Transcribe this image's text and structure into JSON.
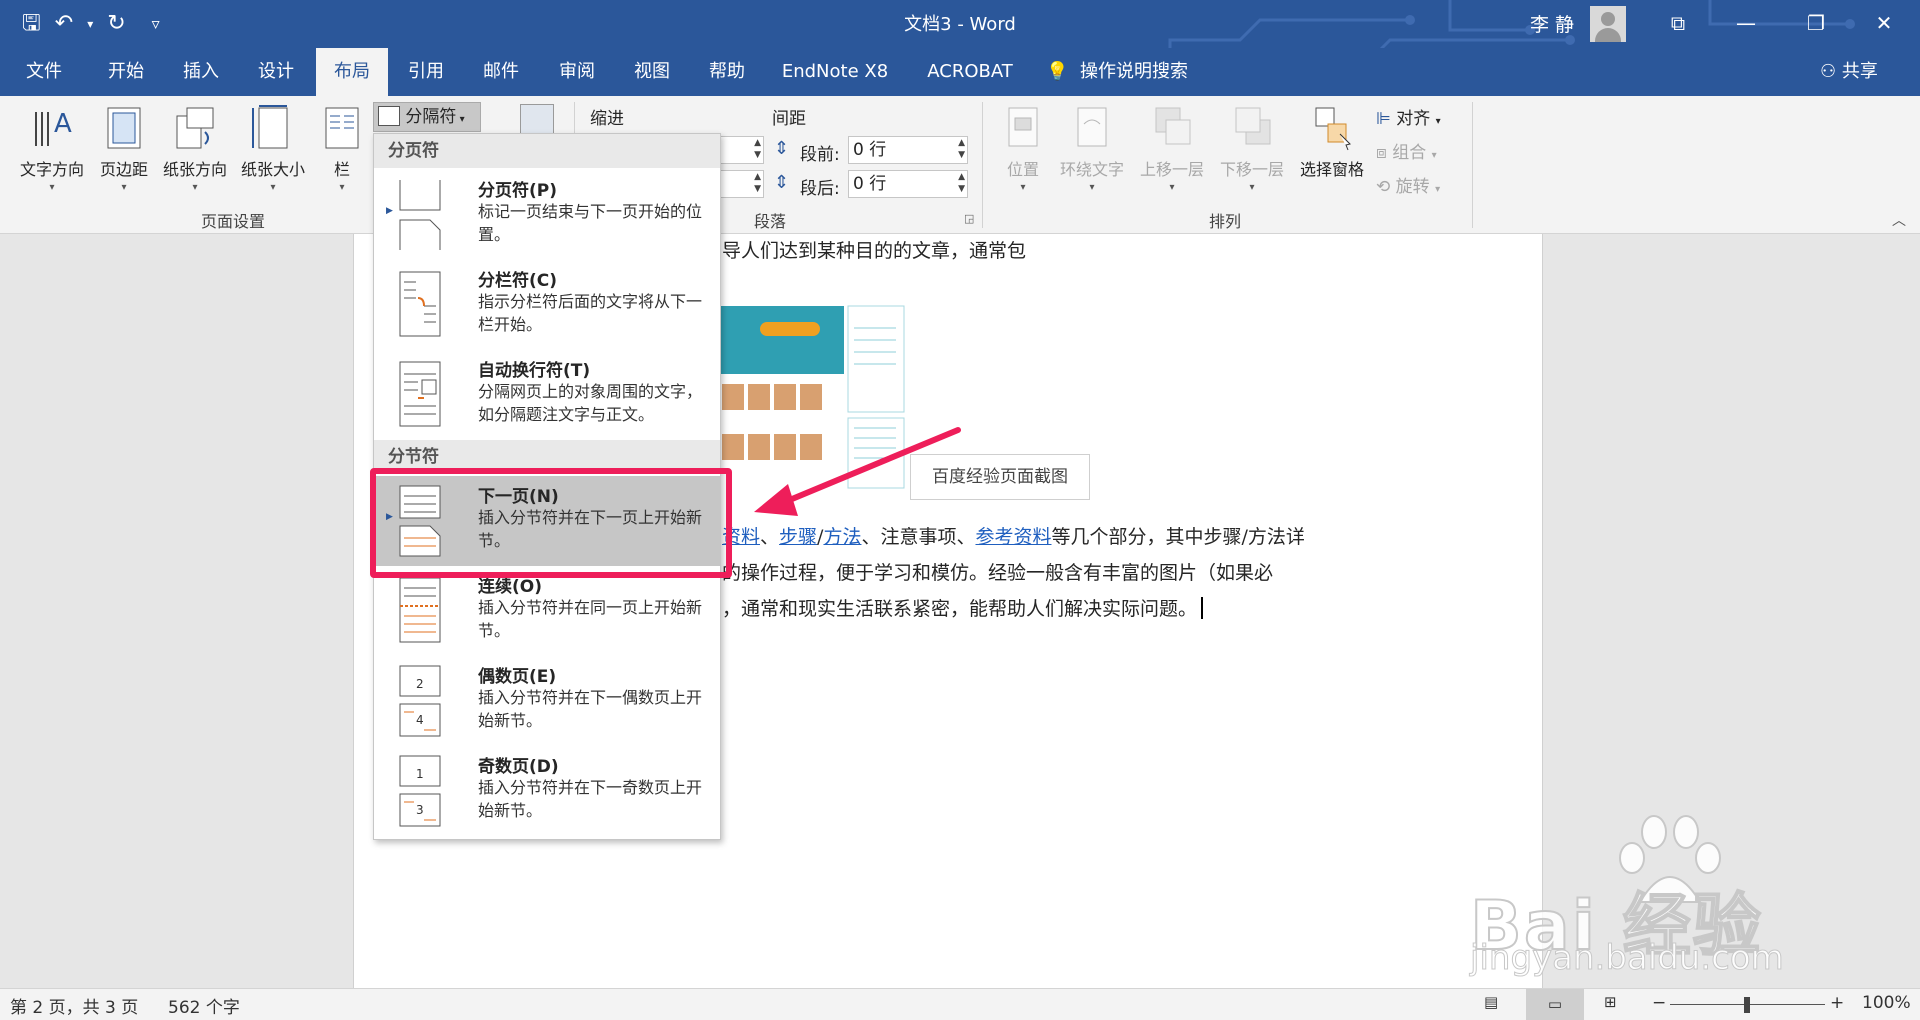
{
  "titlebar": {
    "title": "文档3  -  Word",
    "user": "李 静",
    "qat": {
      "save": "🖫",
      "undo": "↶",
      "undo_caret": "▾",
      "redo": "↻",
      "customize": "▿"
    },
    "controls": {
      "ribbon_display": "⧉",
      "minimize": "—",
      "restore": "❐",
      "close": "✕"
    }
  },
  "tabs": [
    "文件",
    "开始",
    "插入",
    "设计",
    "布局",
    "引用",
    "邮件",
    "审阅",
    "视图",
    "帮助",
    "EndNote X8",
    "ACROBAT",
    "操作说明搜索"
  ],
  "tabs_active": "布局",
  "share": "共享",
  "ribbon": {
    "page_setup": {
      "buttons": [
        "文字方向",
        "页边距",
        "纸张方向",
        "纸张大小",
        "栏"
      ],
      "label": "页面设置"
    },
    "breaks_button": "分隔符",
    "indent_label": "缩进",
    "spacing_label": "间距",
    "before_label": "段前:",
    "before_value": "0 行",
    "after_label": "段后:",
    "after_value": "0 行",
    "paragraph_label": "段落",
    "arrange": {
      "buttons": [
        "位置",
        "环绕文字",
        "上移一层",
        "下移一层",
        "选择窗格"
      ],
      "small": [
        "对齐",
        "组合",
        "旋转"
      ],
      "label": "排列"
    }
  },
  "dropdown": {
    "page_breaks_header": "分页符",
    "section_breaks_header": "分节符",
    "items": [
      {
        "name": "分页符(P)",
        "desc": "标记一页结束与下一页开始的位置。"
      },
      {
        "name": "分栏符(C)",
        "desc": "指示分栏符后面的文字将从下一栏开始。"
      },
      {
        "name": "自动换行符(T)",
        "desc": "分隔网页上的对象周围的文字，如分隔题注文字与正文。"
      },
      {
        "name": "下一页(N)",
        "desc": "插入分节符并在下一页上开始新节。"
      },
      {
        "name": "连续(O)",
        "desc": "插入分节符并在同一页上开始新节。"
      },
      {
        "name": "偶数页(E)",
        "desc": "插入分节符并在下一偶数页上开始新节。"
      },
      {
        "name": "奇数页(D)",
        "desc": "插入分节符并在下一奇数页上开始新节。"
      }
    ]
  },
  "document": {
    "line1": "导人们达到某种目的的文章，通常包",
    "caption": "百度经验页面截图",
    "line2_links": [
      "资料",
      "步骤",
      "方法",
      "参考资料"
    ],
    "line2_seps": [
      "、",
      "/",
      "、注意事项、"
    ],
    "line2_tail": "等几个部分，其中步骤/方法详",
    "line3": "的操作过程，便于学习和模仿。经验一般含有丰富的图片（如果必",
    "line4": "，通常和现实生活联系紧密，能帮助人们解决实际问题。"
  },
  "statusbar": {
    "page": "第 2 页，共 3 页",
    "words": "562 个字",
    "zoom": "100%",
    "zoom_level_percent": 100
  },
  "watermark": {
    "brand": "Bai  经验",
    "url": "jingyan.baidu.com"
  },
  "colors": {
    "brand": "#2b579a",
    "highlight": "#ee1e5a"
  }
}
